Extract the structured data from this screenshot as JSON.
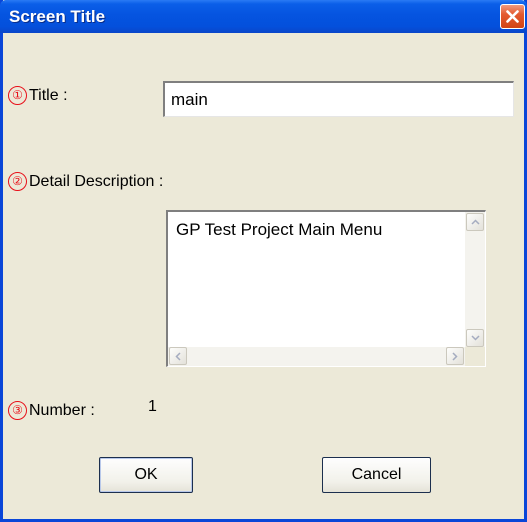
{
  "window": {
    "title": "Screen Title"
  },
  "fields": {
    "title": {
      "number": "①",
      "label": "Title :",
      "value": "main"
    },
    "description": {
      "number": "②",
      "label": "Detail Description :",
      "value": "GP Test Project Main Menu"
    },
    "number": {
      "number": "③",
      "label": "Number :",
      "value": "1"
    }
  },
  "buttons": {
    "ok_label": "OK",
    "cancel_label": "Cancel"
  },
  "colors": {
    "titlebar": "#0554e0",
    "close": "#e45a30",
    "marker": "#e8101a",
    "dialog_bg": "#ece9d8"
  },
  "icons": [
    "close-icon",
    "scroll-up-icon",
    "scroll-down-icon",
    "scroll-left-icon",
    "scroll-right-icon"
  ]
}
